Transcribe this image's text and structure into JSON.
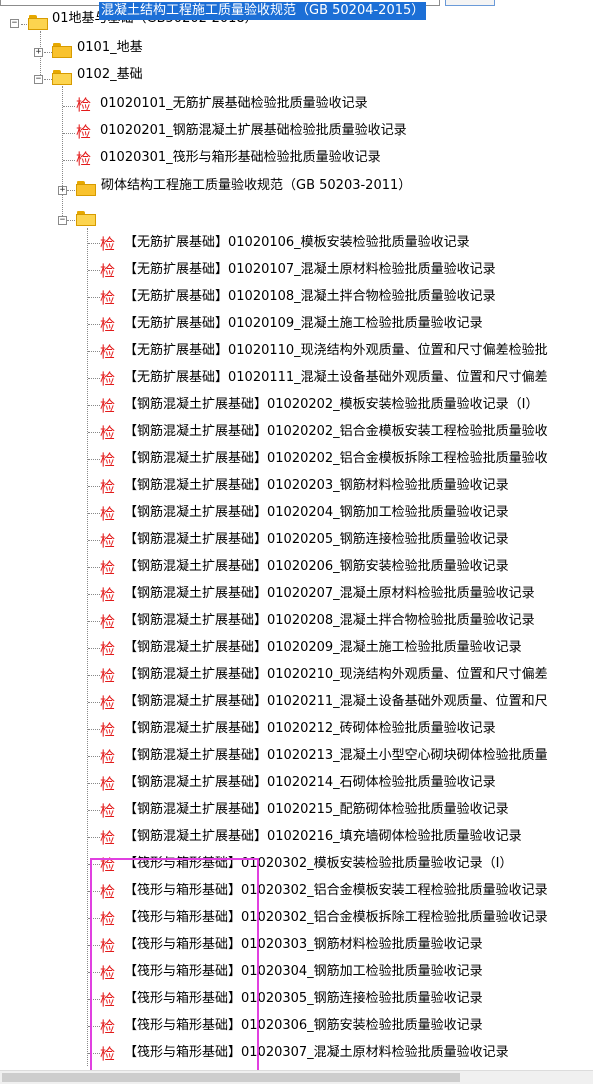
{
  "tree": {
    "root": {
      "label": "01地基与基础（GB50202-2018）"
    },
    "nodes": [
      {
        "label": "0101_地基"
      },
      {
        "label": "0102_基础"
      },
      {
        "label": "砌体结构工程施工质量验收规范（GB 50203-2011）"
      },
      {
        "label": "混凝土结构工程施工质量验收规范（GB 50204-2015）",
        "selected": true
      }
    ],
    "check_glyph": "检",
    "basis_items": [
      "01020101_无筋扩展基础检验批质量验收记录",
      "01020201_钢筋混凝土扩展基础检验批质量验收记录",
      "01020301_筏形与箱形基础检验批质量验收记录"
    ],
    "concrete_items": [
      "【无筋扩展基础】01020106_模板安装检验批质量验收记录",
      "【无筋扩展基础】01020107_混凝土原材料检验批质量验收记录",
      "【无筋扩展基础】01020108_混凝土拌合物检验批质量验收记录",
      "【无筋扩展基础】01020109_混凝土施工检验批质量验收记录",
      "【无筋扩展基础】01020110_现浇结构外观质量、位置和尺寸偏差检验批",
      "【无筋扩展基础】01020111_混凝土设备基础外观质量、位置和尺寸偏差",
      "【钢筋混凝土扩展基础】01020202_模板安装检验批质量验收记录（Ⅰ）",
      "【钢筋混凝土扩展基础】01020202_铝合金模板安装工程检验批质量验收",
      "【钢筋混凝土扩展基础】01020202_铝合金模板拆除工程检验批质量验收",
      "【钢筋混凝土扩展基础】01020203_钢筋材料检验批质量验收记录",
      "【钢筋混凝土扩展基础】01020204_钢筋加工检验批质量验收记录",
      "【钢筋混凝土扩展基础】01020205_钢筋连接检验批质量验收记录",
      "【钢筋混凝土扩展基础】01020206_钢筋安装检验批质量验收记录",
      "【钢筋混凝土扩展基础】01020207_混凝土原材料检验批质量验收记录",
      "【钢筋混凝土扩展基础】01020208_混凝土拌合物检验批质量验收记录",
      "【钢筋混凝土扩展基础】01020209_混凝土施工检验批质量验收记录",
      "【钢筋混凝土扩展基础】01020210_现浇结构外观质量、位置和尺寸偏差",
      "【钢筋混凝土扩展基础】01020211_混凝土设备基础外观质量、位置和尺",
      "【钢筋混凝土扩展基础】01020212_砖砌体检验批质量验收记录",
      "【钢筋混凝土扩展基础】01020213_混凝土小型空心砌块砌体检验批质量",
      "【钢筋混凝土扩展基础】01020214_石砌体检验批质量验收记录",
      "【钢筋混凝土扩展基础】01020215_配筋砌体检验批质量验收记录",
      "【钢筋混凝土扩展基础】01020216_填充墙砌体检验批质量验收记录",
      "【筏形与箱形基础】01020302_模板安装检验批质量验收记录（Ⅰ）",
      "【筏形与箱形基础】01020302_铝合金模板安装工程检验批质量验收记录",
      "【筏形与箱形基础】01020302_铝合金模板拆除工程检验批质量验收记录",
      "【筏形与箱形基础】01020303_钢筋材料检验批质量验收记录",
      "【筏形与箱形基础】01020304_钢筋加工检验批质量验收记录",
      "【筏形与箱形基础】01020305_钢筋连接检验批质量验收记录",
      "【筏形与箱形基础】01020306_钢筋安装检验批质量验收记录",
      "【筏形与箱形基础】01020307_混凝土原材料检验批质量验收记录"
    ]
  },
  "colors": {
    "check_glyph": "#e31a1a",
    "selection": "#1c6fd6",
    "highlight_box": "#e040e0"
  },
  "icons": [
    "expand-icon",
    "collapse-icon",
    "folder-icon",
    "folder-open-icon"
  ]
}
